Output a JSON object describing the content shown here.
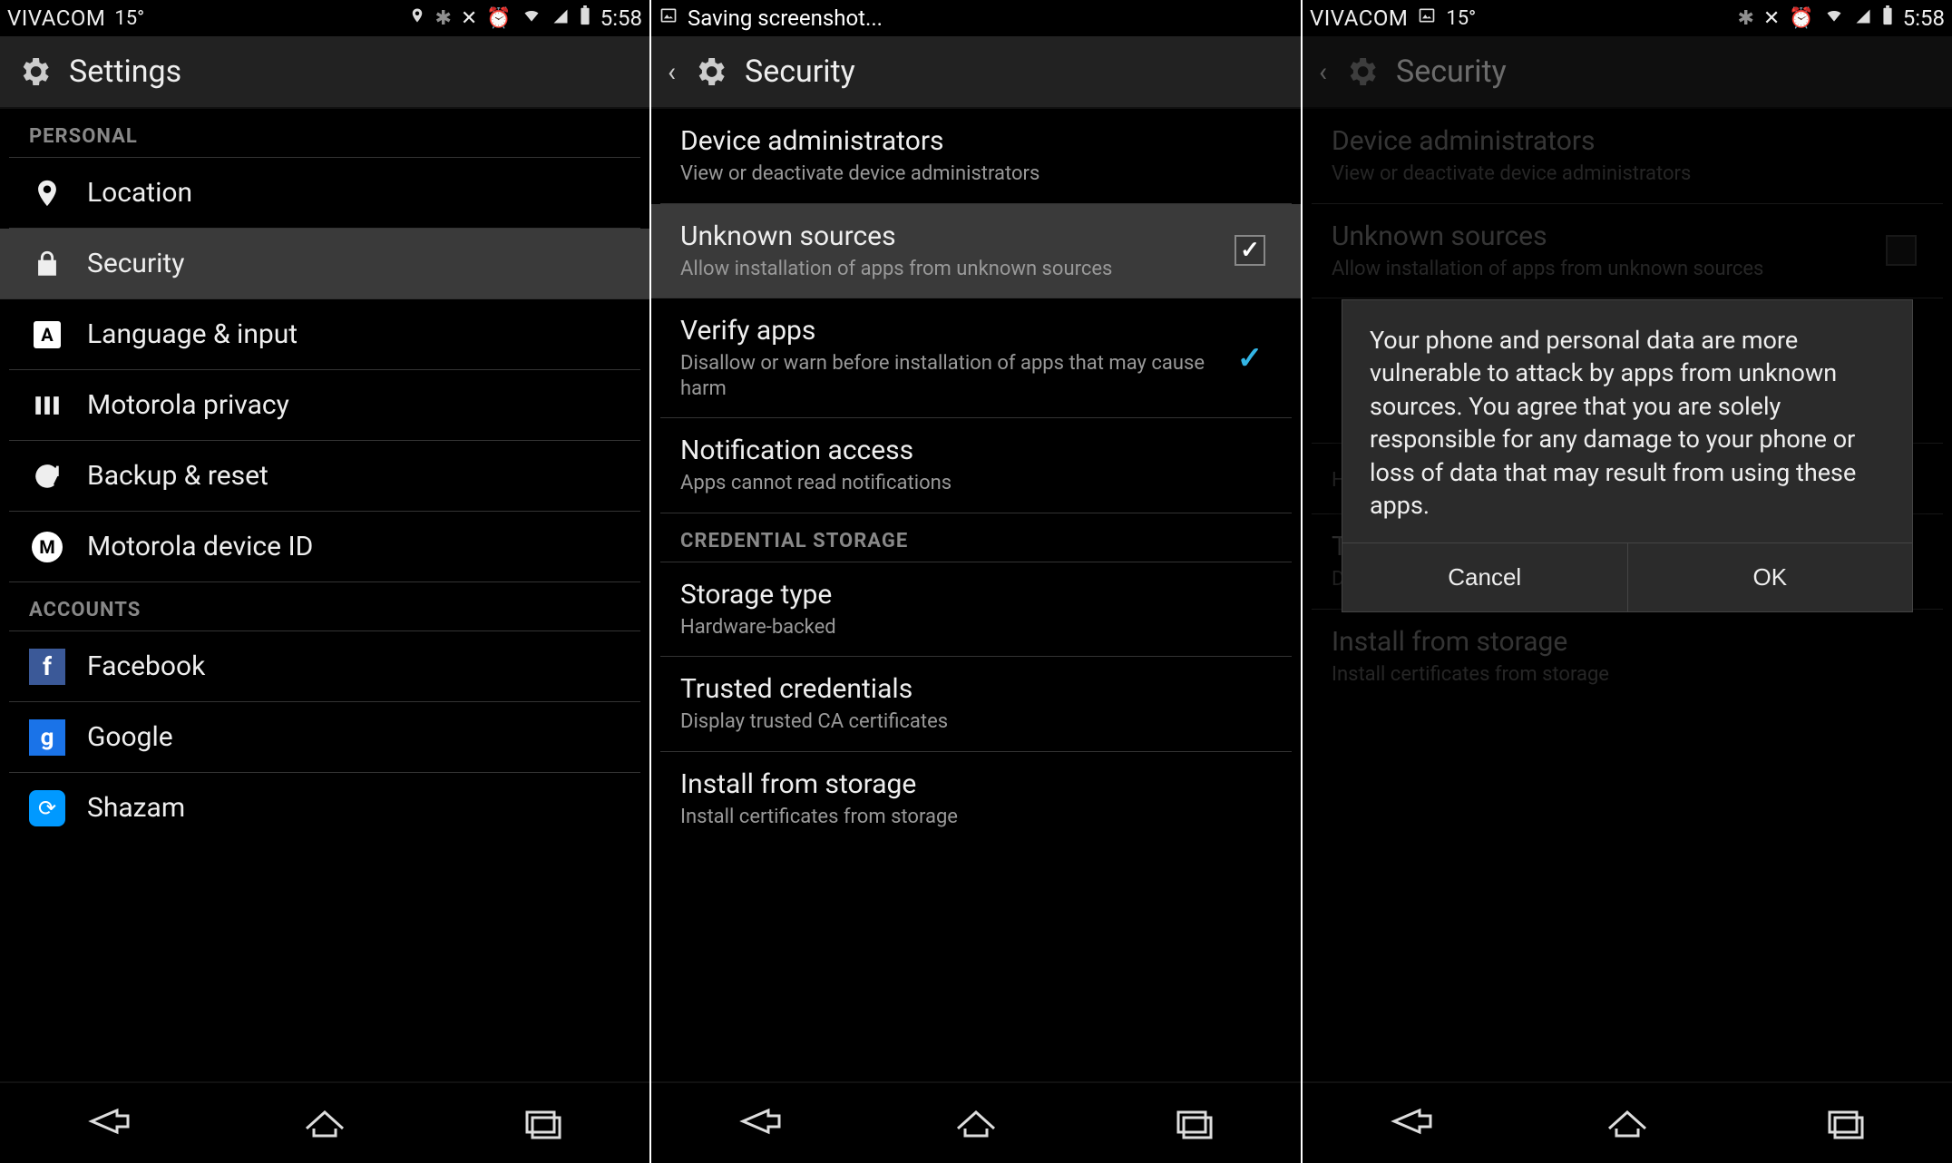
{
  "status": {
    "carrier": "VIVACOM",
    "temp": "15°",
    "clock": "5:58",
    "saving": "Saving screenshot..."
  },
  "screen1": {
    "title": "Settings",
    "sections": {
      "personal": "PERSONAL",
      "accounts": "ACCOUNTS"
    },
    "items": {
      "location": "Location",
      "security": "Security",
      "language": "Language & input",
      "moto_privacy": "Motorola privacy",
      "backup": "Backup & reset",
      "moto_id": "Motorola device ID",
      "facebook": "Facebook",
      "google": "Google",
      "shazam": "Shazam"
    }
  },
  "screen2": {
    "title": "Security",
    "items": {
      "dev_admin_t": "Device administrators",
      "dev_admin_s": "View or deactivate device administrators",
      "unknown_t": "Unknown sources",
      "unknown_s": "Allow installation of apps from unknown sources",
      "verify_t": "Verify apps",
      "verify_s": "Disallow or warn before installation of apps that may cause harm",
      "notif_t": "Notification access",
      "notif_s": "Apps cannot read notifications",
      "cred_header": "CREDENTIAL STORAGE",
      "storage_t": "Storage type",
      "storage_s": "Hardware-backed",
      "trusted_t": "Trusted credentials",
      "trusted_s": "Display trusted CA certificates",
      "install_t": "Install from storage",
      "install_s": "Install certificates from storage"
    }
  },
  "dialog": {
    "body": "Your phone and personal data are more vulnerable to attack by apps from unknown sources. You agree that you are solely responsible for any damage to your phone or loss of data that may result from using these apps.",
    "cancel": "Cancel",
    "ok": "OK"
  }
}
